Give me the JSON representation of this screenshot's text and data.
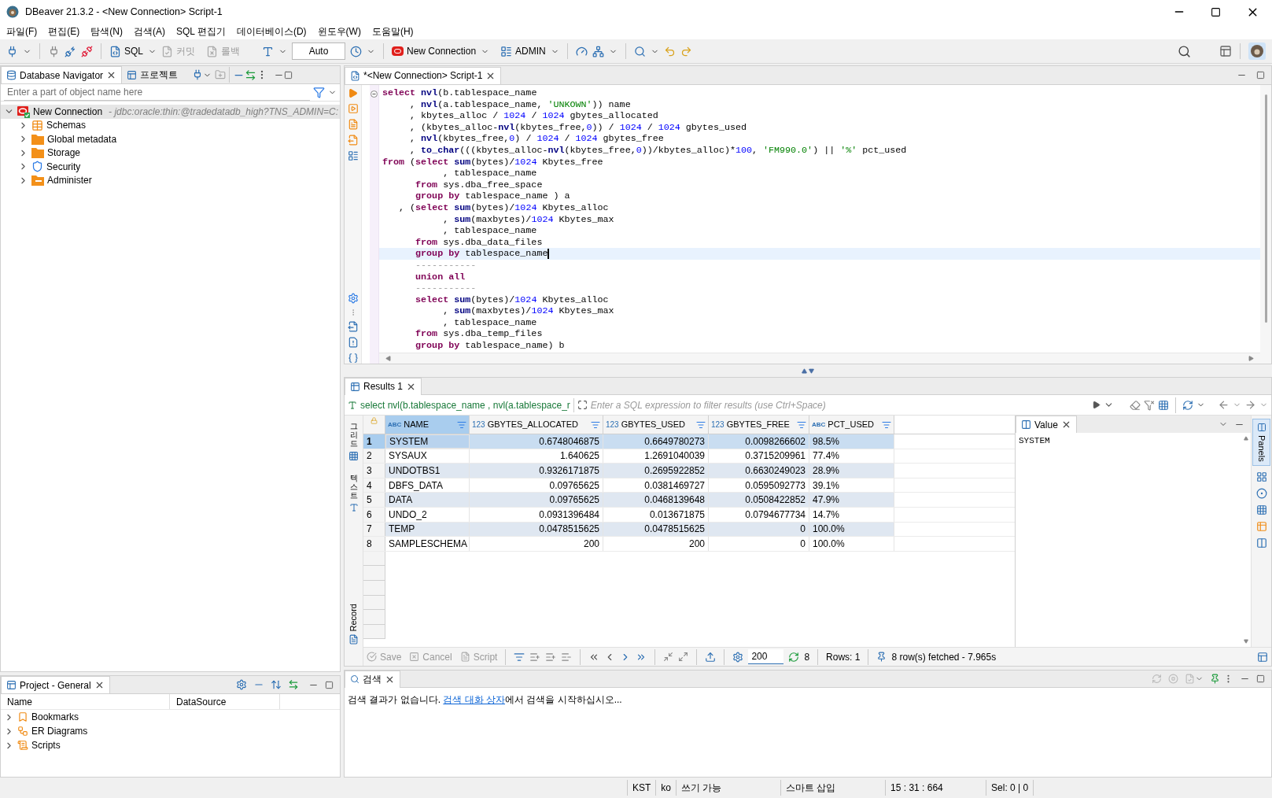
{
  "window": {
    "title": "DBeaver 21.3.2 - <New Connection> Script-1"
  },
  "menu": [
    "파일(F)",
    "편집(E)",
    "탐색(N)",
    "검색(A)",
    "SQL 편집기",
    "데이터베이스(D)",
    "윈도우(W)",
    "도움말(H)"
  ],
  "toolbar": {
    "sql": "SQL",
    "commit": {
      "label": "커밋",
      "disabled": true
    },
    "rollback": {
      "label": "롤백",
      "disabled": true
    },
    "transaction_mode": "Auto",
    "connection": "New Connection",
    "schema": "ADMIN"
  },
  "navigator": {
    "tabs": [
      {
        "label": "Database Navigator",
        "selected": true
      },
      {
        "label": "프로젝트",
        "selected": false
      }
    ],
    "search": {
      "placeholder": "Enter a part of object name here"
    },
    "tree": [
      {
        "label": "New Connection",
        "detail": "- jdbc:oracle:thin:@tradedatadb_high?TNS_ADMIN=C:",
        "expanded": true,
        "selected": true,
        "kind": "connection",
        "children": [
          {
            "label": "Schemas",
            "kind": "schemas",
            "expanded": false,
            "selected": false
          },
          {
            "label": "Global metadata",
            "kind": "folder",
            "expanded": false,
            "selected": false
          },
          {
            "label": "Storage",
            "kind": "folder",
            "expanded": false,
            "selected": false
          },
          {
            "label": "Security",
            "kind": "security",
            "expanded": false,
            "selected": false
          },
          {
            "label": "Administer",
            "kind": "admin",
            "expanded": false,
            "selected": false
          }
        ]
      }
    ]
  },
  "project": {
    "tab": "Project - General",
    "columns": [
      "Name",
      "DataSource"
    ],
    "items": [
      {
        "label": "Bookmarks",
        "kind": "bookmarks"
      },
      {
        "label": "ER Diagrams",
        "kind": "diagrams"
      },
      {
        "label": "Scripts",
        "kind": "scripts"
      }
    ]
  },
  "editor": {
    "tab": "*<New Connection> Script-1",
    "lines": [
      {
        "current": false,
        "tokens": [
          {
            "kind": "kw",
            "t": "select"
          },
          {
            "kind": "fn",
            "t": " nvl"
          },
          {
            "kind": "p",
            "t": "(b.tablespace_name"
          }
        ]
      },
      {
        "current": false,
        "tokens": [
          {
            "kind": "p",
            "t": "     , "
          },
          {
            "kind": "fn",
            "t": "nvl"
          },
          {
            "kind": "p",
            "t": "(a.tablespace_name, "
          },
          {
            "kind": "str",
            "t": "'UNKOWN'"
          },
          {
            "kind": "p",
            "t": ")) name"
          }
        ]
      },
      {
        "current": false,
        "tokens": [
          {
            "kind": "p",
            "t": "     , kbytes_alloc / "
          },
          {
            "kind": "num",
            "t": "1024"
          },
          {
            "kind": "p",
            "t": " / "
          },
          {
            "kind": "num",
            "t": "1024"
          },
          {
            "kind": "p",
            "t": " gbytes_allocated"
          }
        ]
      },
      {
        "current": false,
        "tokens": [
          {
            "kind": "p",
            "t": "     , (kbytes_alloc-"
          },
          {
            "kind": "fn",
            "t": "nvl"
          },
          {
            "kind": "p",
            "t": "(kbytes_free,"
          },
          {
            "kind": "num",
            "t": "0"
          },
          {
            "kind": "p",
            "t": ")) / "
          },
          {
            "kind": "num",
            "t": "1024"
          },
          {
            "kind": "p",
            "t": " / "
          },
          {
            "kind": "num",
            "t": "1024"
          },
          {
            "kind": "p",
            "t": " gbytes_used"
          }
        ]
      },
      {
        "current": false,
        "tokens": [
          {
            "kind": "p",
            "t": "     , "
          },
          {
            "kind": "fn",
            "t": "nvl"
          },
          {
            "kind": "p",
            "t": "(kbytes_free,"
          },
          {
            "kind": "num",
            "t": "0"
          },
          {
            "kind": "p",
            "t": ") / "
          },
          {
            "kind": "num",
            "t": "1024"
          },
          {
            "kind": "p",
            "t": " / "
          },
          {
            "kind": "num",
            "t": "1024"
          },
          {
            "kind": "p",
            "t": " gbytes_free"
          }
        ]
      },
      {
        "current": false,
        "tokens": [
          {
            "kind": "p",
            "t": "     , "
          },
          {
            "kind": "fn",
            "t": "to_char"
          },
          {
            "kind": "p",
            "t": "(((kbytes_alloc-"
          },
          {
            "kind": "fn",
            "t": "nvl"
          },
          {
            "kind": "p",
            "t": "(kbytes_free,"
          },
          {
            "kind": "num",
            "t": "0"
          },
          {
            "kind": "p",
            "t": "))/kbytes_alloc)*"
          },
          {
            "kind": "num",
            "t": "100"
          },
          {
            "kind": "p",
            "t": ", "
          },
          {
            "kind": "str",
            "t": "'FM990.0'"
          },
          {
            "kind": "p",
            "t": ") || "
          },
          {
            "kind": "str",
            "t": "'%'"
          },
          {
            "kind": "p",
            "t": " pct_used"
          }
        ]
      },
      {
        "current": false,
        "tokens": [
          {
            "kind": "kw",
            "t": "from"
          },
          {
            "kind": "p",
            "t": " ("
          },
          {
            "kind": "kw",
            "t": "select"
          },
          {
            "kind": "fn",
            "t": " sum"
          },
          {
            "kind": "p",
            "t": "(bytes)/"
          },
          {
            "kind": "num",
            "t": "1024"
          },
          {
            "kind": "p",
            "t": " Kbytes_free"
          }
        ]
      },
      {
        "current": false,
        "tokens": [
          {
            "kind": "p",
            "t": "           , tablespace_name"
          }
        ]
      },
      {
        "current": false,
        "tokens": [
          {
            "kind": "kw",
            "t": "      from"
          },
          {
            "kind": "p",
            "t": " sys.dba_free_space"
          }
        ]
      },
      {
        "current": false,
        "tokens": [
          {
            "kind": "kw",
            "t": "      group by"
          },
          {
            "kind": "p",
            "t": " tablespace_name ) a"
          }
        ]
      },
      {
        "current": false,
        "tokens": [
          {
            "kind": "p",
            "t": "   , ("
          },
          {
            "kind": "kw",
            "t": "select"
          },
          {
            "kind": "fn",
            "t": " sum"
          },
          {
            "kind": "p",
            "t": "(bytes)/"
          },
          {
            "kind": "num",
            "t": "1024"
          },
          {
            "kind": "p",
            "t": " Kbytes_alloc"
          }
        ]
      },
      {
        "current": false,
        "tokens": [
          {
            "kind": "p",
            "t": "           , "
          },
          {
            "kind": "fn",
            "t": "sum"
          },
          {
            "kind": "p",
            "t": "(maxbytes)/"
          },
          {
            "kind": "num",
            "t": "1024"
          },
          {
            "kind": "p",
            "t": " Kbytes_max"
          }
        ]
      },
      {
        "current": false,
        "tokens": [
          {
            "kind": "p",
            "t": "           , tablespace_name"
          }
        ]
      },
      {
        "current": false,
        "tokens": [
          {
            "kind": "kw",
            "t": "      from"
          },
          {
            "kind": "p",
            "t": " sys.dba_data_files"
          }
        ]
      },
      {
        "current": true,
        "tokens": [
          {
            "kind": "kw",
            "t": "      group by"
          },
          {
            "kind": "p",
            "t": " tablespace_name"
          }
        ]
      },
      {
        "current": false,
        "tokens": [
          {
            "kind": "cm",
            "t": "      -----------"
          }
        ]
      },
      {
        "current": false,
        "tokens": [
          {
            "kind": "kw",
            "t": "      union all"
          }
        ]
      },
      {
        "current": false,
        "tokens": [
          {
            "kind": "cm",
            "t": "      -----------"
          }
        ]
      },
      {
        "current": false,
        "tokens": [
          {
            "kind": "kw",
            "t": "      select"
          },
          {
            "kind": "fn",
            "t": " sum"
          },
          {
            "kind": "p",
            "t": "(bytes)/"
          },
          {
            "kind": "num",
            "t": "1024"
          },
          {
            "kind": "p",
            "t": " Kbytes_alloc"
          }
        ]
      },
      {
        "current": false,
        "tokens": [
          {
            "kind": "p",
            "t": "           , "
          },
          {
            "kind": "fn",
            "t": "sum"
          },
          {
            "kind": "p",
            "t": "(maxbytes)/"
          },
          {
            "kind": "num",
            "t": "1024"
          },
          {
            "kind": "p",
            "t": " Kbytes_max"
          }
        ]
      },
      {
        "current": false,
        "tokens": [
          {
            "kind": "p",
            "t": "           , tablespace_name"
          }
        ]
      },
      {
        "current": false,
        "tokens": [
          {
            "kind": "kw",
            "t": "      from"
          },
          {
            "kind": "p",
            "t": " sys.dba_temp_files"
          }
        ]
      },
      {
        "current": false,
        "tokens": [
          {
            "kind": "kw",
            "t": "      group by"
          },
          {
            "kind": "p",
            "t": " tablespace_name) b"
          }
        ]
      }
    ]
  },
  "results": {
    "tab": "Results 1",
    "query": "select nvl(b.tablespace_name , nvl(a.tablespace_r",
    "filter": {
      "placeholder": "Enter a SQL expression to filter results (use Ctrl+Space)"
    },
    "side_tabs": [
      {
        "label": "그리드",
        "kind": "stacked"
      },
      {
        "label": "텍스트",
        "kind": "stacked"
      },
      {
        "label": "Record",
        "kind": "rotated"
      }
    ],
    "columns": [
      {
        "type": "ABC",
        "label": "NAME"
      },
      {
        "type": "123",
        "label": "GBYTES_ALLOCATED"
      },
      {
        "type": "123",
        "label": "GBYTES_USED"
      },
      {
        "type": "123",
        "label": "GBYTES_FREE"
      },
      {
        "type": "ABC",
        "label": "PCT_USED"
      }
    ],
    "rows": [
      {
        "num": "1",
        "selected": true,
        "cells": [
          "SYSTEM",
          "0.6748046875",
          "0.6649780273",
          "0.0098266602",
          "98.5%"
        ]
      },
      {
        "num": "2",
        "selected": false,
        "cells": [
          "SYSAUX",
          "1.640625",
          "1.2691040039",
          "0.3715209961",
          "77.4%"
        ]
      },
      {
        "num": "3",
        "selected": false,
        "cells": [
          "UNDOTBS1",
          "0.9326171875",
          "0.2695922852",
          "0.6630249023",
          "28.9%"
        ]
      },
      {
        "num": "4",
        "selected": false,
        "cells": [
          "DBFS_DATA",
          "0.09765625",
          "0.0381469727",
          "0.0595092773",
          "39.1%"
        ]
      },
      {
        "num": "5",
        "selected": false,
        "cells": [
          "DATA",
          "0.09765625",
          "0.0468139648",
          "0.0508422852",
          "47.9%"
        ]
      },
      {
        "num": "6",
        "selected": false,
        "cells": [
          "UNDO_2",
          "0.0931396484",
          "0.013671875",
          "0.0794677734",
          "14.7%"
        ]
      },
      {
        "num": "7",
        "selected": false,
        "cells": [
          "TEMP",
          "0.0478515625",
          "0.0478515625",
          "0",
          "100.0%"
        ]
      },
      {
        "num": "8",
        "selected": false,
        "cells": [
          "SAMPLESCHEMA",
          "200",
          "200",
          "0",
          "100.0%"
        ]
      }
    ],
    "value_panel": {
      "tab": "Value",
      "value": "SYSTEM"
    },
    "side_panel_tab": "Panels",
    "bottom": {
      "save": {
        "label": "Save",
        "disabled": true
      },
      "cancel": {
        "label": "Cancel",
        "disabled": true
      },
      "script": {
        "label": "Script",
        "disabled": true
      },
      "fetch_size": "200",
      "count": "8",
      "rows": "Rows: 1",
      "status": "8 row(s) fetched - 7.965s"
    }
  },
  "search_panel": {
    "tab": "검색",
    "message_before": "검색 결과가 없습니다. ",
    "link": "검색 대화 상자",
    "message_after": "에서 검색을 시작하십시오..."
  },
  "status_bar": [
    "KST",
    "ko",
    "쓰기 가능",
    "스마트 삽입",
    "15 : 31 : 664",
    "Sel: 0 | 0"
  ]
}
